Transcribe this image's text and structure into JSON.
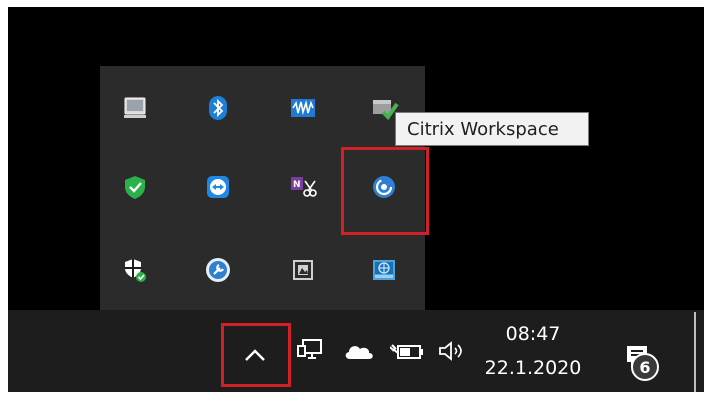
{
  "tooltip": {
    "text": "Citrix Workspace"
  },
  "overflow_tray": {
    "icons": [
      {
        "name": "monitor-icon",
        "color": "#c8c8c8"
      },
      {
        "name": "bluetooth-icon",
        "color": "#1e7fd8"
      },
      {
        "name": "waves-icon",
        "color": "#1f7ad6"
      },
      {
        "name": "drive-check-icon",
        "color": "#4caf50"
      },
      {
        "name": "windows-defender-icon",
        "color": "#2bb14a"
      },
      {
        "name": "teamviewer-icon",
        "color": "#1e88e5"
      },
      {
        "name": "onenote-clip-icon",
        "color": "#7a3e9d"
      },
      {
        "name": "citrix-workspace-icon",
        "color": "#2f7fd3"
      },
      {
        "name": "security-shield-icon",
        "color": "#ffffff"
      },
      {
        "name": "wrench-circle-icon",
        "color": "#2f7fd3"
      },
      {
        "name": "image-frame-icon",
        "color": "#d0d0d0"
      },
      {
        "name": "network-globe-icon",
        "color": "#4aa3df"
      }
    ]
  },
  "taskbar": {
    "show_hidden_icons": {
      "glyph": "^",
      "icon": "chevron-up-icon"
    },
    "system_icons": [
      "network-icon",
      "onedrive-cloud-icon",
      "battery-plug-icon",
      "volume-icon"
    ],
    "clock": {
      "time": "08:47",
      "date": "22.1.2020"
    },
    "notifications": {
      "icon": "action-center-icon",
      "count": "6"
    }
  },
  "highlight_color": "#d22027"
}
